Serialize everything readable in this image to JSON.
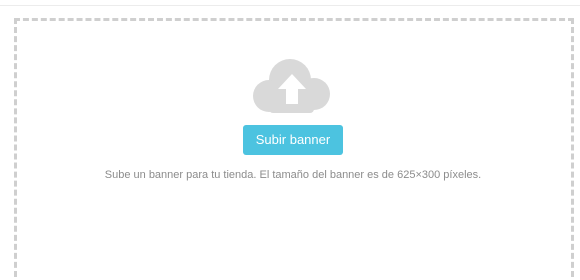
{
  "upload": {
    "icon": "cloud-upload-icon",
    "button_label": "Subir banner",
    "help_text": "Sube un banner para tu tienda. El tamaño del banner es de 625×300 píxeles."
  },
  "colors": {
    "button_bg": "#4cc3e0",
    "icon_fill": "#d9d9d9",
    "border": "#cfcfcf",
    "help_text": "#8c8c8c"
  }
}
